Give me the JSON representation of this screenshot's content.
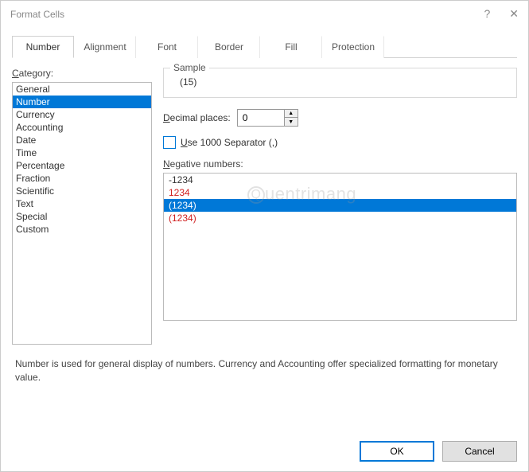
{
  "window": {
    "title": "Format Cells",
    "help_icon": "?",
    "close_icon": "✕"
  },
  "tabs": [
    {
      "label": "Number",
      "active": true
    },
    {
      "label": "Alignment",
      "active": false
    },
    {
      "label": "Font",
      "active": false
    },
    {
      "label": "Border",
      "active": false
    },
    {
      "label": "Fill",
      "active": false
    },
    {
      "label": "Protection",
      "active": false
    }
  ],
  "category": {
    "label": "Category:",
    "items": [
      "General",
      "Number",
      "Currency",
      "Accounting",
      "Date",
      "Time",
      "Percentage",
      "Fraction",
      "Scientific",
      "Text",
      "Special",
      "Custom"
    ],
    "selected_index": 1
  },
  "sample": {
    "legend": "Sample",
    "value": "(15)"
  },
  "decimal": {
    "label": "Decimal places:",
    "value": "0"
  },
  "separator": {
    "label": "Use 1000 Separator (,)",
    "checked": false
  },
  "negative": {
    "label": "Negative numbers:",
    "items": [
      {
        "text": "-1234",
        "style": "black"
      },
      {
        "text": "1234",
        "style": "red"
      },
      {
        "text": "(1234)",
        "style": "black"
      },
      {
        "text": "(1234)",
        "style": "red"
      }
    ],
    "selected_index": 2
  },
  "description": "Number is used for general display of numbers.  Currency and Accounting offer specialized formatting for monetary value.",
  "buttons": {
    "ok": "OK",
    "cancel": "Cancel"
  },
  "watermark": "uentrimang"
}
